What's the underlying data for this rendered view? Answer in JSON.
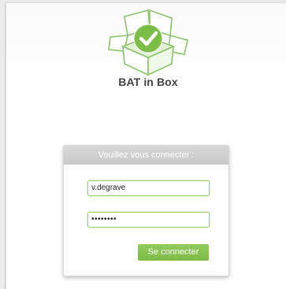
{
  "app": {
    "title": "BAT in Box",
    "logo_icon": "box-checkmark-icon"
  },
  "login": {
    "header": "Veuillez vous connecter :",
    "username_value": "v.degrave",
    "password_mask": "••••••••",
    "submit_label": "Se connecter"
  },
  "colors": {
    "accent_green": "#7dbb45",
    "header_gray": "#cfcfcf"
  }
}
